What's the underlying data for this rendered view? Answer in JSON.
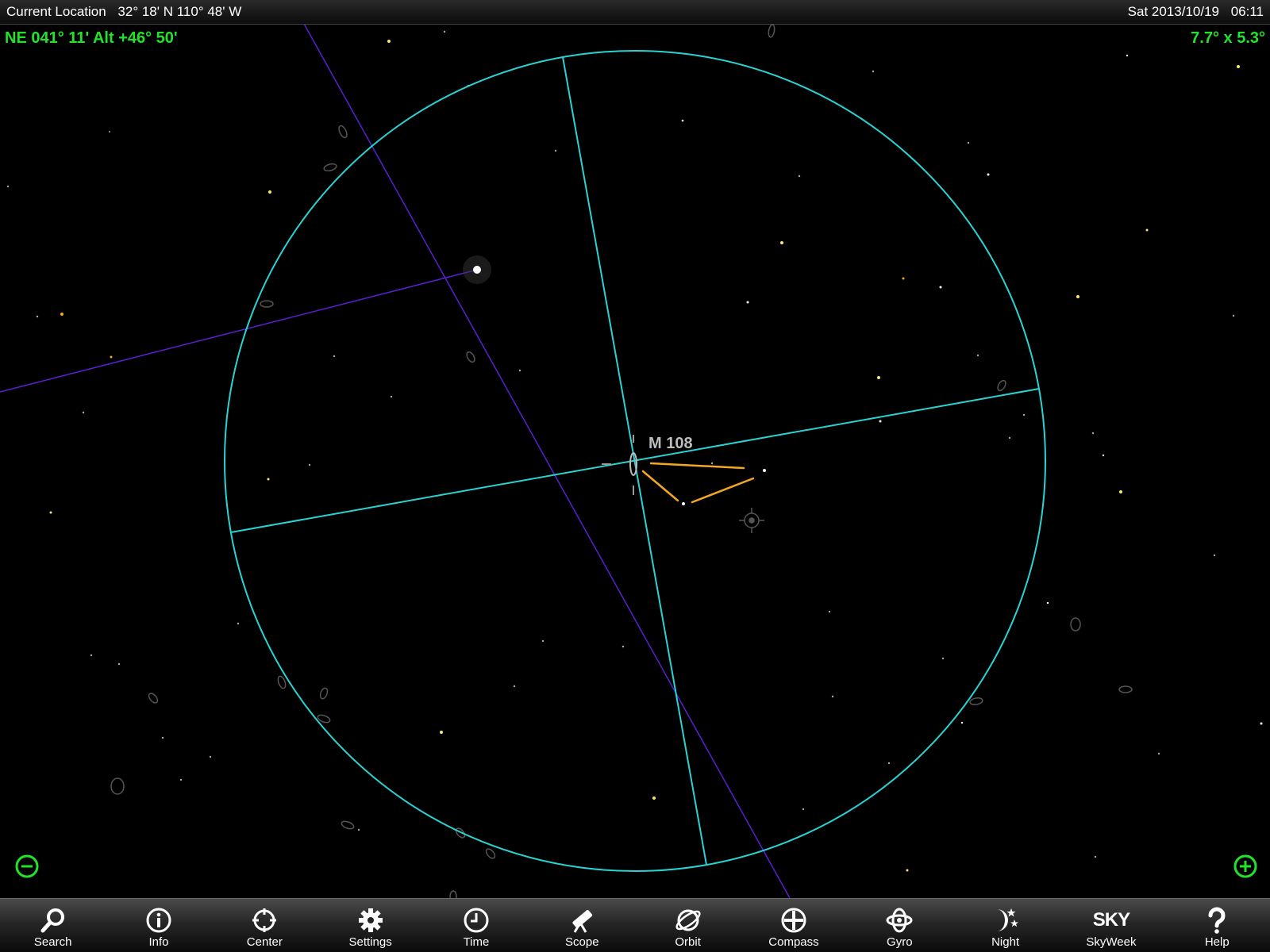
{
  "status_bar": {
    "location_label": "Current Location",
    "coordinates": "32° 18' N 110° 48' W",
    "date": "Sat 2013/10/19",
    "time": "06:11"
  },
  "pointing_readout": "NE 041° 11' Alt +46° 50'",
  "fov_readout": "7.7° x  5.3°",
  "sky": {
    "target_label": "M 108"
  },
  "colors": {
    "readout": "#22e22a",
    "fov_circle": "#2ad3d3",
    "meridian_line": "#5a1fd0",
    "constellation_line": "#f5a623"
  },
  "toolbar": {
    "items": [
      {
        "id": "search",
        "label": "Search",
        "icon": "magnifier-icon"
      },
      {
        "id": "info",
        "label": "Info",
        "icon": "info-icon"
      },
      {
        "id": "center",
        "label": "Center",
        "icon": "crosshair-icon"
      },
      {
        "id": "settings",
        "label": "Settings",
        "icon": "gear-icon"
      },
      {
        "id": "time",
        "label": "Time",
        "icon": "clock-icon"
      },
      {
        "id": "scope",
        "label": "Scope",
        "icon": "telescope-icon"
      },
      {
        "id": "orbit",
        "label": "Orbit",
        "icon": "orbit-icon"
      },
      {
        "id": "compass",
        "label": "Compass",
        "icon": "compass-icon"
      },
      {
        "id": "gyro",
        "label": "Gyro",
        "icon": "gyro-icon"
      },
      {
        "id": "night",
        "label": "Night",
        "icon": "moon-stars-icon"
      },
      {
        "id": "skyweek",
        "label": "SkyWeek",
        "icon": "sky-logo-icon",
        "logo_text": "SKY"
      },
      {
        "id": "help",
        "label": "Help",
        "icon": "question-icon"
      }
    ]
  }
}
